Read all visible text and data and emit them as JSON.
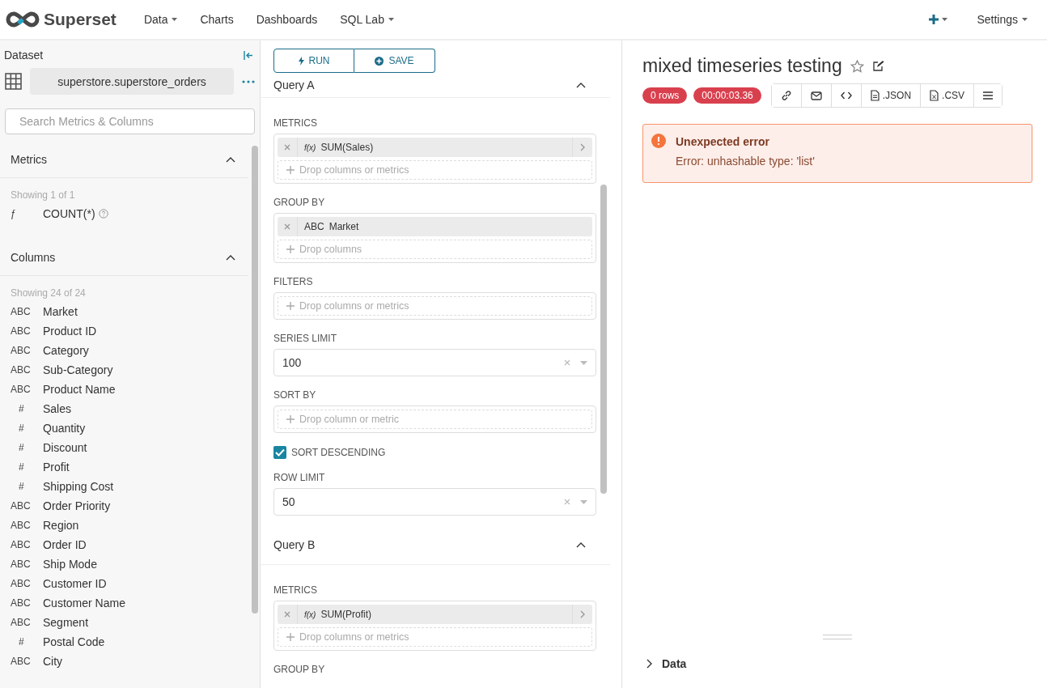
{
  "navbar": {
    "brand": "Superset",
    "menu": [
      {
        "label": "Data",
        "dropdown": true
      },
      {
        "label": "Charts",
        "dropdown": false
      },
      {
        "label": "Dashboards",
        "dropdown": false
      },
      {
        "label": "SQL Lab",
        "dropdown": true
      }
    ],
    "settings": "Settings"
  },
  "datasource": {
    "heading": "Dataset",
    "name": "superstore.superstore_orders",
    "search_placeholder": "Search Metrics & Columns",
    "metrics": {
      "title": "Metrics",
      "expanded": true,
      "showing": "Showing 1 of 1",
      "items": [
        {
          "type": "ƒ",
          "name": "COUNT(*)"
        }
      ]
    },
    "columns": {
      "title": "Columns",
      "expanded": true,
      "showing": "Showing 24 of 24",
      "items": [
        {
          "type": "ABC",
          "name": "Market"
        },
        {
          "type": "ABC",
          "name": "Product ID"
        },
        {
          "type": "ABC",
          "name": "Category"
        },
        {
          "type": "ABC",
          "name": "Sub-Category"
        },
        {
          "type": "ABC",
          "name": "Product Name"
        },
        {
          "type": "#",
          "name": "Sales"
        },
        {
          "type": "#",
          "name": "Quantity"
        },
        {
          "type": "#",
          "name": "Discount"
        },
        {
          "type": "#",
          "name": "Profit"
        },
        {
          "type": "#",
          "name": "Shipping Cost"
        },
        {
          "type": "ABC",
          "name": "Order Priority"
        },
        {
          "type": "ABC",
          "name": "Region"
        },
        {
          "type": "ABC",
          "name": "Order ID"
        },
        {
          "type": "ABC",
          "name": "Ship Mode"
        },
        {
          "type": "ABC",
          "name": "Customer ID"
        },
        {
          "type": "ABC",
          "name": "Customer Name"
        },
        {
          "type": "ABC",
          "name": "Segment"
        },
        {
          "type": "#",
          "name": "Postal Code"
        },
        {
          "type": "ABC",
          "name": "City"
        }
      ]
    }
  },
  "actions": [
    {
      "label": "RUN",
      "kind": "run"
    },
    {
      "label": "SAVE",
      "kind": "save"
    }
  ],
  "queries": [
    {
      "title": "Query A",
      "expanded": true,
      "controls": [
        {
          "kind": "drop",
          "label": "METRICS",
          "items": [
            {
              "kind": "metric",
              "prefix": "f(x)",
              "label": "SUM(Sales)"
            }
          ],
          "placeholder": "Drop columns or metrics"
        },
        {
          "kind": "drop",
          "label": "GROUP BY",
          "items": [
            {
              "kind": "column",
              "prefix": "ABC",
              "label": "Market"
            }
          ],
          "placeholder": "Drop columns"
        },
        {
          "kind": "drop",
          "label": "FILTERS",
          "placeholder": "Drop columns or metrics"
        },
        {
          "kind": "select",
          "label": "SERIES LIMIT",
          "value": "100"
        },
        {
          "kind": "drop",
          "label": "SORT BY",
          "placeholder": "Drop column or metric"
        },
        {
          "kind": "checkbox",
          "label": "SORT DESCENDING",
          "checked": true
        },
        {
          "kind": "select",
          "label": "ROW LIMIT",
          "value": "50"
        }
      ]
    },
    {
      "title": "Query B",
      "expanded": true,
      "controls": [
        {
          "kind": "drop",
          "label": "METRICS",
          "items": [
            {
              "kind": "metric",
              "prefix": "f(x)",
              "label": "SUM(Profit)"
            }
          ],
          "placeholder": "Drop columns or metrics"
        },
        {
          "kind": "label",
          "label": "GROUP BY"
        }
      ]
    }
  ],
  "chart": {
    "title": "mixed timeseries testing",
    "rows": "0 rows",
    "elapsed": "00:00:03.36",
    "toolbar": [
      {
        "kind": "link"
      },
      {
        "kind": "mail"
      },
      {
        "kind": "embed"
      },
      {
        "kind": "file",
        "label": ".JSON"
      },
      {
        "kind": "csv",
        "label": ".CSV"
      },
      {
        "kind": "menu"
      }
    ],
    "error": {
      "title": "Unexpected error",
      "message": "Error: unhashable type: 'list'"
    },
    "data_panel": {
      "title": "Data",
      "expanded": false
    }
  }
}
